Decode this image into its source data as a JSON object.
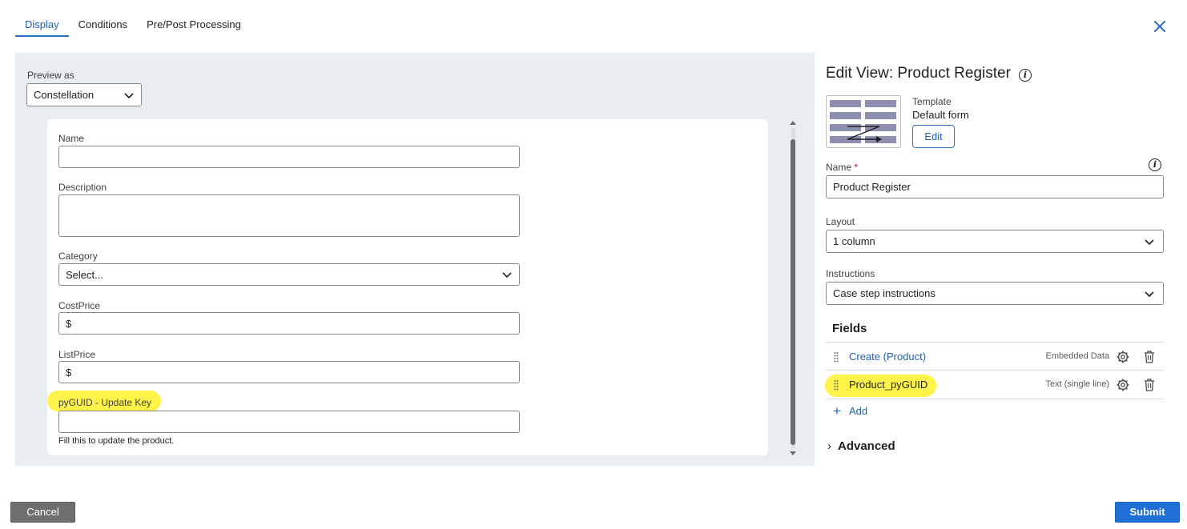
{
  "tabs": [
    {
      "label": "Display",
      "active": true
    },
    {
      "label": "Conditions",
      "active": false
    },
    {
      "label": "Pre/Post Processing",
      "active": false
    }
  ],
  "preview": {
    "label": "Preview as",
    "selected": "Constellation"
  },
  "form": {
    "name_label": "Name",
    "name_value": "",
    "description_label": "Description",
    "description_value": "",
    "category_label": "Category",
    "category_value": "Select...",
    "costprice_label": "CostPrice",
    "costprice_value": "$",
    "listprice_label": "ListPrice",
    "listprice_value": "$",
    "pyguid_label": "pyGUID - Update Key",
    "pyguid_value": "",
    "pyguid_helper": "Fill this to update the product."
  },
  "edit_view": {
    "title": "Edit View: Product Register",
    "template_label": "Template",
    "template_value": "Default form",
    "edit_button": "Edit",
    "name_label": "Name",
    "name_required": "*",
    "name_value": "Product Register",
    "layout_label": "Layout",
    "layout_value": "1 column",
    "instructions_label": "Instructions",
    "instructions_value": "Case step instructions",
    "fields_title": "Fields",
    "fields": [
      {
        "name": "Create (Product)",
        "type": "Embedded Data"
      },
      {
        "name": "Product_pyGUID",
        "type": "Text (single line)"
      }
    ],
    "add_label": "Add",
    "add_icon": "+",
    "advanced_label": "Advanced",
    "advanced_icon": "›"
  },
  "footer": {
    "cancel": "Cancel",
    "submit": "Submit"
  },
  "colors": {
    "accent": "#1f6fd6",
    "highlight": "#fff34a",
    "panel_bg": "#e8edf2",
    "cancel_bg": "#6f6f6f"
  },
  "icons": {
    "close": "close-icon",
    "chevron": "chevron-down-icon",
    "info": "info-icon",
    "gear": "gear-icon",
    "trash": "trash-icon",
    "grip": "drag-handle-icon"
  }
}
